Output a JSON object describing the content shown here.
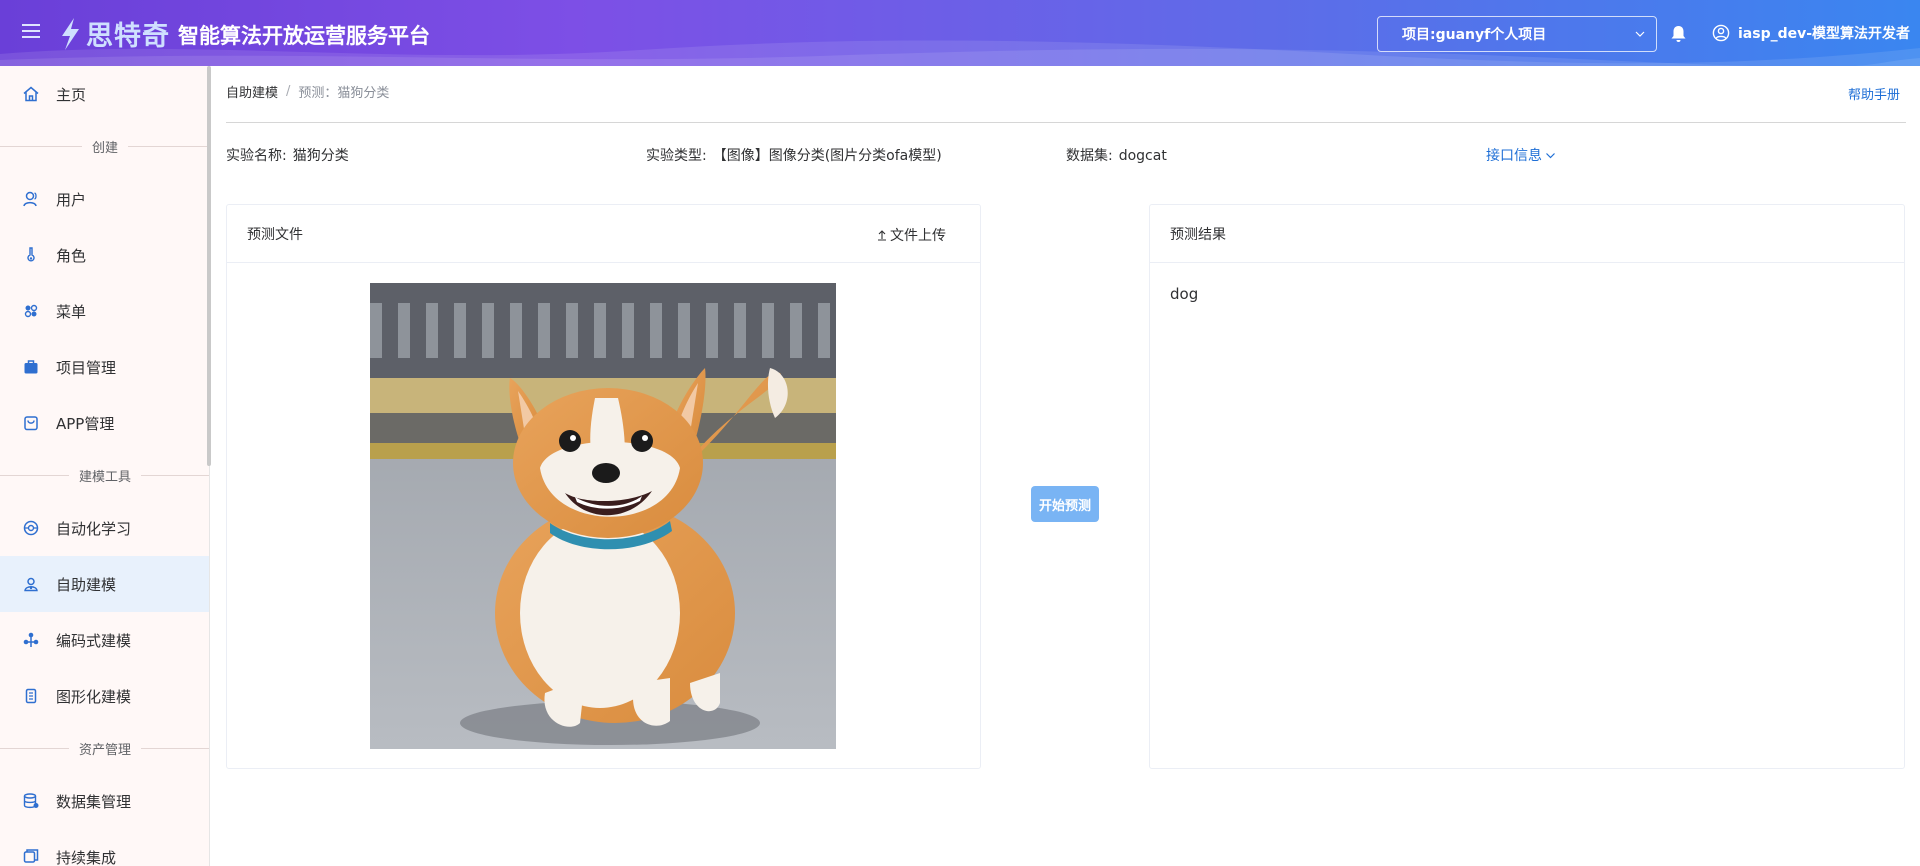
{
  "header": {
    "logo_name": "思特奇",
    "platform_title": "智能算法开放运营服务平台",
    "project_label": "项目:",
    "project_value": "guanyf个人项目",
    "username": "iasp_dev-模型算法开发者",
    "colors": {
      "gradient_start": "#6a3fd8",
      "gradient_end": "#3a86f0"
    }
  },
  "sidebar": {
    "items": [
      {
        "label": "主页",
        "icon": "home-icon"
      },
      {
        "label": "用户",
        "icon": "user-icon"
      },
      {
        "label": "角色",
        "icon": "role-icon"
      },
      {
        "label": "菜单",
        "icon": "menu-grid-icon"
      },
      {
        "label": "项目管理",
        "icon": "briefcase-icon"
      },
      {
        "label": "APP管理",
        "icon": "bag-icon"
      },
      {
        "label": "自动化学习",
        "icon": "auto-learn-icon"
      },
      {
        "label": "自助建模",
        "icon": "self-model-icon",
        "active": true
      },
      {
        "label": "编码式建模",
        "icon": "code-model-icon"
      },
      {
        "label": "图形化建模",
        "icon": "graphic-model-icon"
      },
      {
        "label": "数据集管理",
        "icon": "database-icon"
      },
      {
        "label": "持续集成",
        "icon": "ci-icon"
      }
    ],
    "groups": {
      "create": "创建",
      "tools": "建模工具",
      "assets": "资产管理"
    }
  },
  "breadcrumb": {
    "parent": "自助建模",
    "separator": "/",
    "current": "预测：猫狗分类"
  },
  "help_link": "帮助手册",
  "experiment": {
    "name_label": "实验名称:",
    "name_value": "猫狗分类",
    "type_label": "实验类型:",
    "type_value": "【图像】图像分类(图片分类ofa模型)",
    "dataset_label": "数据集:",
    "dataset_value": "dogcat",
    "api_info": "接口信息"
  },
  "predict_file": {
    "title": "预测文件",
    "upload_label": "文件上传"
  },
  "start_button": "开始预测",
  "predict_result": {
    "title": "预测结果",
    "value": "dog"
  }
}
